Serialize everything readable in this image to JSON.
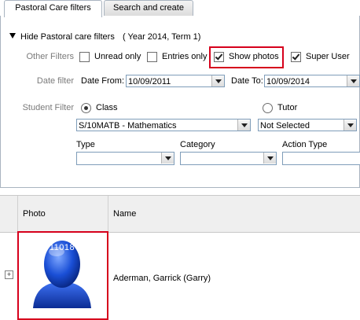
{
  "tabs": [
    {
      "label": "Pastoral Care filters",
      "active": true
    },
    {
      "label": "Search and create",
      "active": false
    }
  ],
  "filters": {
    "header_toggle": "Hide Pastoral care filters",
    "period": "( Year 2014, Term 1)",
    "other_filters_label": "Other Filters",
    "unread_only": {
      "label": "Unread only",
      "checked": false
    },
    "entries_only": {
      "label": "Entries only",
      "checked": false
    },
    "show_photos": {
      "label": "Show photos",
      "checked": true
    },
    "super_user": {
      "label": "Super User",
      "checked": true
    },
    "date_filter_label": "Date filter",
    "date_from_label": "Date From:",
    "date_from_value": "10/09/2011",
    "date_to_label": "Date To:",
    "date_to_value": "10/09/2014",
    "student_filter_label": "Student Filter",
    "class_radio": {
      "label": "Class",
      "selected": true
    },
    "tutor_radio": {
      "label": "Tutor",
      "selected": false
    },
    "class_value": "S/10MATB - Mathematics",
    "tutor_value": "Not Selected",
    "type_label": "Type",
    "category_label": "Category",
    "action_type_label": "Action Type",
    "type_value": "",
    "category_value": "",
    "action_type_value": ""
  },
  "table": {
    "columns": [
      "Photo",
      "Name"
    ],
    "rows": [
      {
        "expand": "+",
        "photo_id": "11018",
        "name": "Aderman, Garrick (Garry)"
      }
    ]
  },
  "colors": {
    "highlight": "#d6001c",
    "photo_blue": "#1a4fd6"
  }
}
